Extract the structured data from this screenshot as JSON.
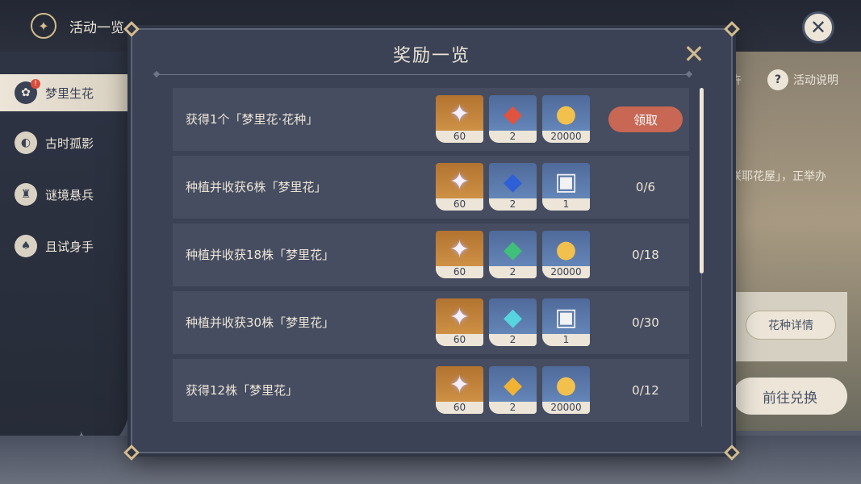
{
  "header": {
    "title": "活动一览",
    "compass_icon": "compass-icon",
    "close_icon": "close-icon"
  },
  "sidebar": {
    "items": [
      {
        "label": "梦里生花",
        "active": true,
        "icon": "flower-pot-icon",
        "badge": "!"
      },
      {
        "label": "古时孤影",
        "active": false,
        "icon": "shadow-icon"
      },
      {
        "label": "谜境悬兵",
        "active": false,
        "icon": "puzzle-helmet-icon"
      },
      {
        "label": "且试身手",
        "active": false,
        "icon": "cards-icon"
      }
    ]
  },
  "background": {
    "partial_label": "卉",
    "help_label": "活动说明",
    "desc_fragment": "咲耶花屋」，正举办",
    "seed_details_label": "花种详情",
    "exchange_label": "前往兑换"
  },
  "modal": {
    "title": "奖励一览",
    "rows": [
      {
        "label": "获得1个「梦里花·花种」",
        "rewards": [
          {
            "kind": "primogem",
            "qty": "60"
          },
          {
            "kind": "red-gem",
            "qty": "2"
          },
          {
            "kind": "mora",
            "qty": "20000"
          }
        ],
        "claim_label": "领取",
        "progress": ""
      },
      {
        "label": "种植并收获6株「梦里花」",
        "rewards": [
          {
            "kind": "primogem",
            "qty": "60"
          },
          {
            "kind": "blue-gem",
            "qty": "2"
          },
          {
            "kind": "gift-box",
            "qty": "1"
          }
        ],
        "claim_label": "",
        "progress": "0/6"
      },
      {
        "label": "种植并收获18株「梦里花」",
        "rewards": [
          {
            "kind": "primogem",
            "qty": "60"
          },
          {
            "kind": "green-gem",
            "qty": "2"
          },
          {
            "kind": "mora",
            "qty": "20000"
          }
        ],
        "claim_label": "",
        "progress": "0/18"
      },
      {
        "label": "种植并收获30株「梦里花」",
        "rewards": [
          {
            "kind": "primogem",
            "qty": "60"
          },
          {
            "kind": "cyan-gem",
            "qty": "2"
          },
          {
            "kind": "gift-box",
            "qty": "1"
          }
        ],
        "claim_label": "",
        "progress": "0/30"
      },
      {
        "label": "获得12株「梦里花」",
        "rewards": [
          {
            "kind": "primogem",
            "qty": "60"
          },
          {
            "kind": "gold-gem",
            "qty": "2"
          },
          {
            "kind": "mora",
            "qty": "20000"
          }
        ],
        "claim_label": "",
        "progress": "0/12"
      }
    ]
  },
  "colors": {
    "panel": "#3b4255",
    "row": "#464d60",
    "accent_gold": "#d3bc8e",
    "claim": "#c76754",
    "text": "#ece5d8"
  }
}
